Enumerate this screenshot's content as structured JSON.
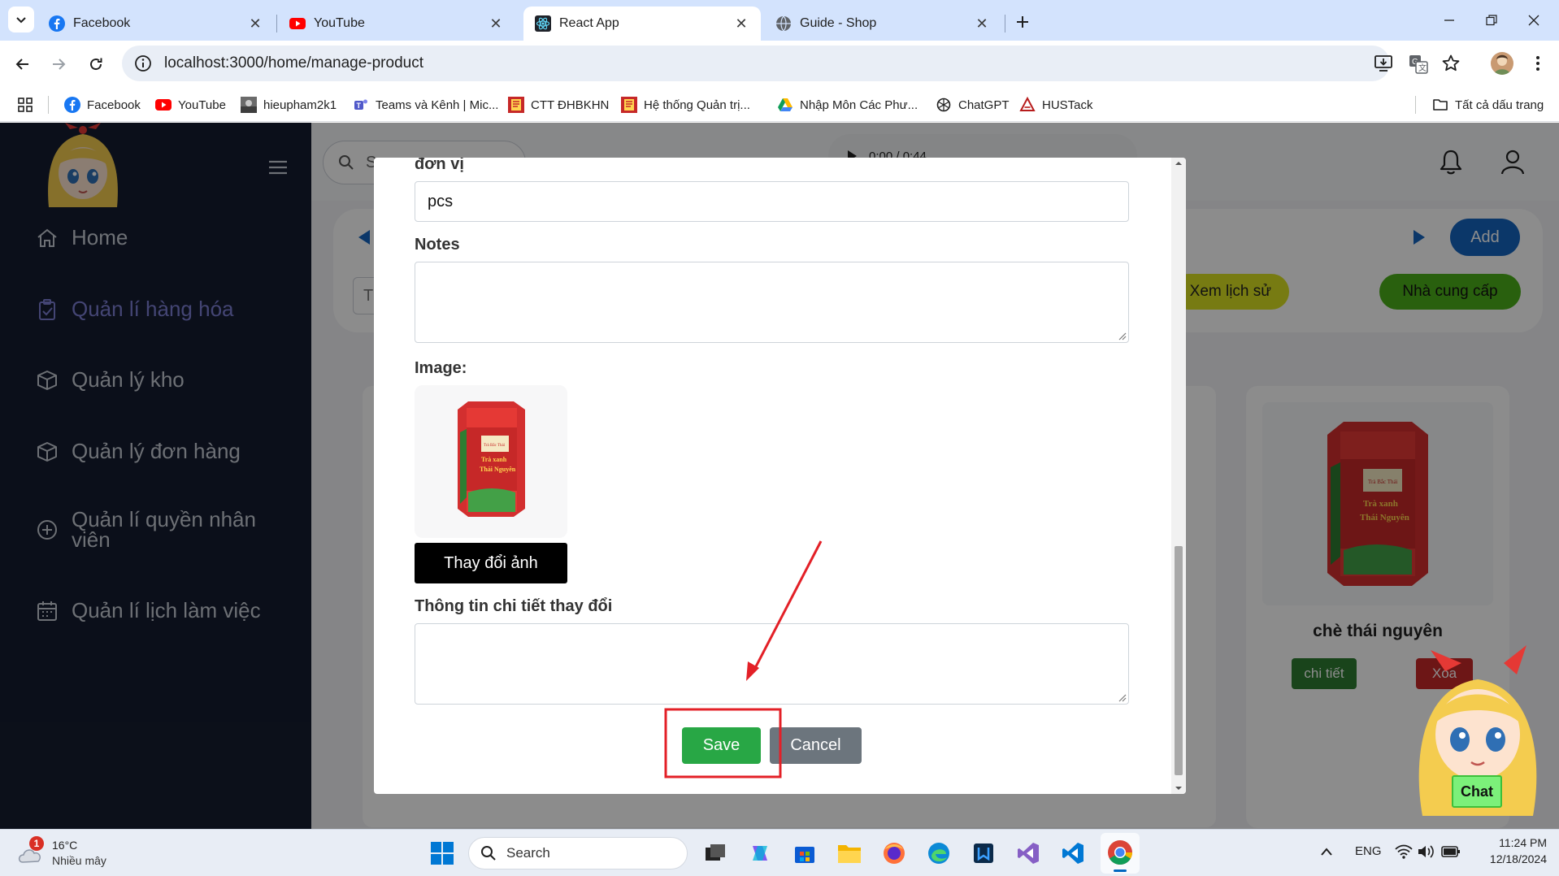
{
  "browser": {
    "tabs": [
      {
        "title": "Facebook",
        "icon": "facebook-icon",
        "active": false
      },
      {
        "title": "YouTube",
        "icon": "youtube-icon",
        "active": false
      },
      {
        "title": "React App",
        "icon": "react-icon",
        "active": true
      },
      {
        "title": "Guide - Shop",
        "icon": "globe-icon",
        "active": false
      }
    ],
    "url": "localhost:3000/home/manage-product",
    "bookmarks": [
      {
        "label": "Facebook",
        "icon": "facebook-icon"
      },
      {
        "label": "YouTube",
        "icon": "youtube-icon"
      },
      {
        "label": "hieupham2k1",
        "icon": "profile-icon"
      },
      {
        "label": "Teams và Kênh | Mic...",
        "icon": "teams-icon"
      },
      {
        "label": "CTT ĐHBKHN",
        "icon": "hust-icon"
      },
      {
        "label": "Hệ thống Quản trị...",
        "icon": "hust-icon"
      },
      {
        "label": "Nhập Môn Các Phư...",
        "icon": "drive-icon"
      },
      {
        "label": "ChatGPT",
        "icon": "chatgpt-icon"
      },
      {
        "label": "HUSTack",
        "icon": "hustack-icon"
      }
    ],
    "all_bookmarks": "Tất cả dấu trang"
  },
  "sidebar": {
    "items": [
      {
        "label": "Home",
        "icon": "home-icon",
        "active": false
      },
      {
        "label": "Quản lí hàng hóa",
        "icon": "clipboard-icon",
        "active": true
      },
      {
        "label": "Quản lý kho",
        "icon": "box-icon",
        "active": false
      },
      {
        "label": "Quản lý đơn hàng",
        "icon": "box-icon",
        "active": false
      },
      {
        "label": "Quản lí quyền nhân viên",
        "icon": "plus-circle-icon",
        "active": false
      },
      {
        "label": "Quản lí lịch làm việc",
        "icon": "calendar-icon",
        "active": false
      }
    ]
  },
  "header": {
    "search_placeholder": "S",
    "audio_time": "0:00 / 0:44"
  },
  "toolbar": {
    "add_label": "Add",
    "history_label": "Xem lịch sử",
    "supplier_label": "Nhà cung cấp",
    "filter_placeholder": "T"
  },
  "product_card": {
    "name": "chè thái nguyên",
    "detail_label": "chi tiết",
    "delete_label": "Xóa"
  },
  "modal": {
    "unit_label": "đơn vị",
    "unit_value": "pcs",
    "notes_label": "Notes",
    "image_label": "Image:",
    "change_image_label": "Thay đổi ảnh",
    "details_label": "Thông tin chi tiết thay đổi",
    "save_label": "Save",
    "cancel_label": "Cancel",
    "tin_text_line1": "Trà Bắc Thái",
    "tin_text_line2": "Trà xanh",
    "tin_text_line3": "Thái Nguyên"
  },
  "chat_widget": {
    "label": "Chat"
  },
  "taskbar": {
    "weather_temp": "16°C",
    "weather_desc": "Nhiều mây",
    "weather_badge": "1",
    "search_label": "Search",
    "language": "ENG",
    "time": "11:24 PM",
    "date": "12/18/2024"
  },
  "colors": {
    "sidebar_bg": "#151d30",
    "accent_blue": "#1565c0",
    "save_green": "#28a745",
    "cancel_gray": "#6c757d",
    "history_yellow": "#d9e021",
    "supplier_green": "#4caf1a",
    "annotation_red": "#e32027"
  }
}
